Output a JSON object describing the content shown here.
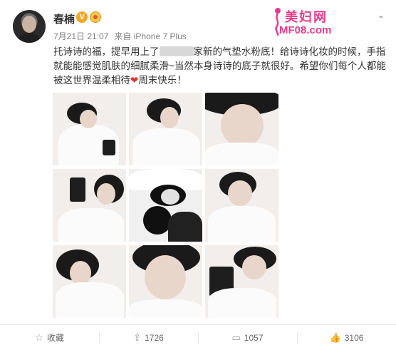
{
  "post": {
    "username": "春楠",
    "timestamp": "7月21日 21:07",
    "source_prefix": "来自",
    "source": "iPhone 7 Plus",
    "text_part1": "托诗诗的福，提早用上了",
    "text_part2": "家新的气垫水粉底！给诗诗化妆的时候，手指就能能感觉肌肤的细腻柔滑~当然本身诗诗的底子就很好。希望你们每个人都能被这世界温柔相待",
    "text_part3": "周末快乐！",
    "heart_glyph": "❤"
  },
  "watermark": {
    "line1": "美妇网",
    "line2": "MF08.com"
  },
  "images": [
    {
      "id": 1,
      "tone": "color"
    },
    {
      "id": 2,
      "tone": "color"
    },
    {
      "id": 3,
      "tone": "color"
    },
    {
      "id": 4,
      "tone": "color"
    },
    {
      "id": 5,
      "tone": "bw"
    },
    {
      "id": 6,
      "tone": "color"
    },
    {
      "id": 7,
      "tone": "color"
    },
    {
      "id": 8,
      "tone": "color"
    },
    {
      "id": 9,
      "tone": "color"
    }
  ],
  "footer": {
    "favorite_label": "收藏",
    "repost_count": "1726",
    "comment_count": "1057",
    "like_count": "3106"
  },
  "icons": {
    "favorite": "star-outline-icon",
    "repost": "repost-arrow-icon",
    "comment": "comment-bubble-icon",
    "like": "thumbs-up-icon",
    "menu": "chevron-down-icon"
  },
  "colors": {
    "text": "#333333",
    "meta": "#808080",
    "verified_badge": "#f5a623",
    "watermark": "#e63b8a",
    "heart": "#e03a2f"
  }
}
